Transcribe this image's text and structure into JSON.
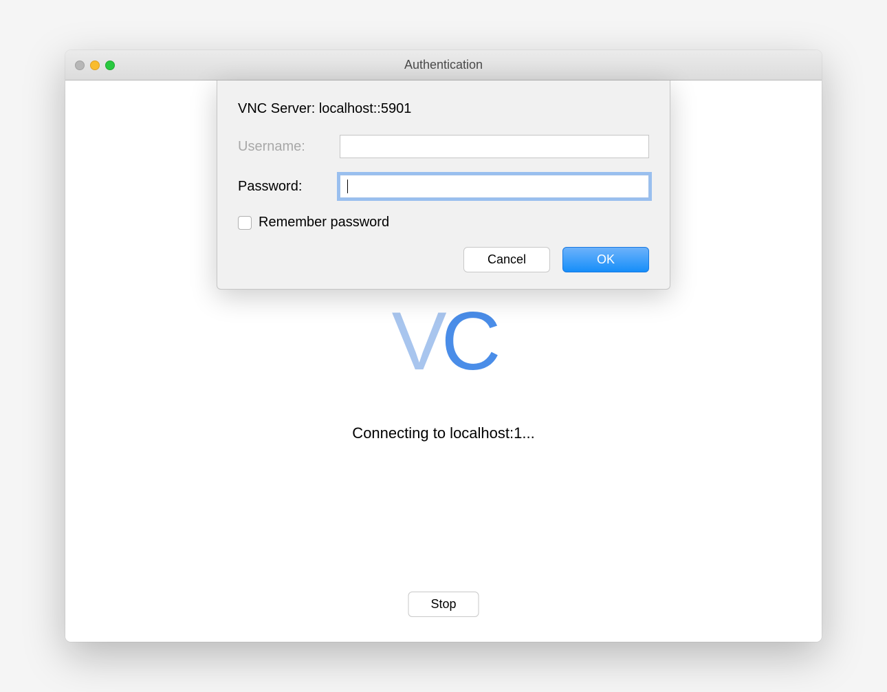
{
  "window": {
    "title": "Authentication"
  },
  "background": {
    "logo_v": "V",
    "logo_c": "C",
    "status": "Connecting to localhost:1...",
    "stop_label": "Stop"
  },
  "auth": {
    "server_label": "VNC Server:",
    "server_value": "localhost::5901",
    "username_label": "Username:",
    "username_value": "",
    "password_label": "Password:",
    "password_value": "",
    "remember_label": "Remember password",
    "remember_checked": false,
    "cancel_label": "Cancel",
    "ok_label": "OK"
  }
}
